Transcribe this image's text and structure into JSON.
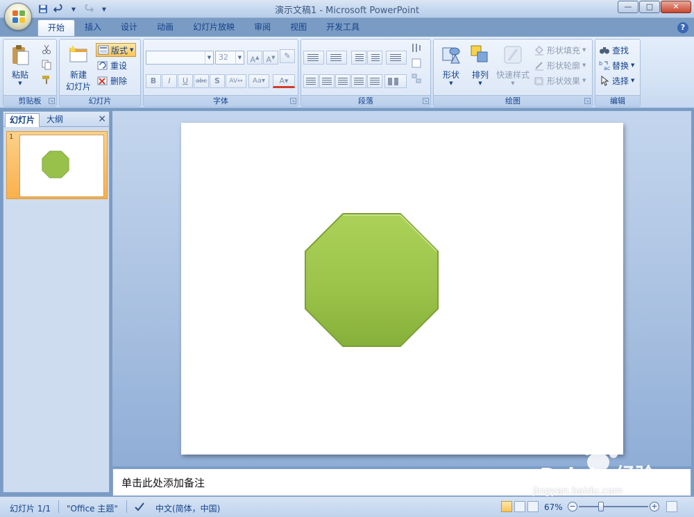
{
  "window": {
    "title": "演示文稿1 - Microsoft PowerPoint",
    "minimize": "—",
    "maximize": "□",
    "close": "✕"
  },
  "tabs": [
    {
      "label": "开始",
      "active": true
    },
    {
      "label": "插入"
    },
    {
      "label": "设计"
    },
    {
      "label": "动画"
    },
    {
      "label": "幻灯片放映"
    },
    {
      "label": "审阅"
    },
    {
      "label": "视图"
    },
    {
      "label": "开发工具"
    }
  ],
  "ribbon": {
    "clipboard": {
      "label": "剪贴板",
      "paste": "粘贴"
    },
    "slides": {
      "label": "幻灯片",
      "new_slide_line1": "新建",
      "new_slide_line2": "幻灯片",
      "layout": "版式",
      "reset": "重设",
      "delete": "删除"
    },
    "font": {
      "label": "字体",
      "font_name": "",
      "font_size": "32"
    },
    "paragraph": {
      "label": "段落"
    },
    "drawing": {
      "label": "绘图",
      "shapes": "形状",
      "arrange": "排列",
      "quick_styles": "快速样式",
      "shape_fill": "形状填充",
      "shape_outline": "形状轮廓",
      "shape_effects": "形状效果"
    },
    "editing": {
      "label": "编辑",
      "find": "查找",
      "replace": "替换",
      "select": "选择"
    }
  },
  "panel": {
    "tab_slides": "幻灯片",
    "tab_outline": "大纲",
    "slide_number": "1"
  },
  "slide": {
    "shape": "octagon",
    "shape_color": "#9bc24a"
  },
  "notes": {
    "placeholder": "单击此处添加备注"
  },
  "watermark": {
    "brand": "Bai du 经验",
    "url": "jingyan.baidu.com"
  },
  "status": {
    "slide_count": "幻灯片 1/1",
    "theme": "\"Office 主题\"",
    "language": "中文(简体，中国)",
    "zoom": "67%"
  }
}
